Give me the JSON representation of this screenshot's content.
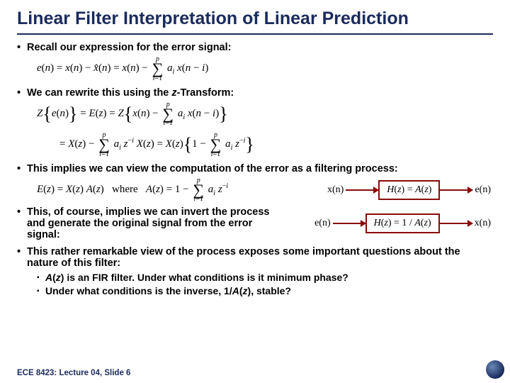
{
  "title": "Linear Filter Interpretation of Linear Prediction",
  "bullets": {
    "recall": "Recall our expression for the error signal:",
    "rewrite": "We can rewrite this using the z-Transform:",
    "implies_filter": "This implies we can view the computation of the error as a filtering process:",
    "invert": "This, of course, implies we can invert the process and generate the original signal from the error signal:",
    "questions": "This rather remarkable view of the process exposes some important questions about the nature of this filter:",
    "sub_a": "A(z) is an FIR filter. Under what conditions is it minimum phase?",
    "sub_b": "Under what conditions is the inverse, 1/A(z), stable?"
  },
  "equations": {
    "error": "e(n) = x(n) − x̂(n) = x(n) − Σ_{i=1}^{p} a_i x(n − i)",
    "ztrans_line1": "Z{ e(n) } = E(z) = Z{ x(n) − Σ_{i=1}^{p} a_i x(n − i) }",
    "ztrans_line2": "= X(z) − Σ_{i=1}^{p} a_i z^{−i} X(z) = X(z){ 1 − Σ_{i=1}^{p} a_i z^{−i} }",
    "ez_def": "E(z) = X(z) A(z)   where   A(z) = 1 − Σ_{i=1}^{p} a_i z^{−i}"
  },
  "diagram1": {
    "in": "x(n)",
    "box": "H(z) = A(z)",
    "out": "e(n)"
  },
  "diagram2": {
    "in": "e(n)",
    "box": "H(z) = 1 / A(z)",
    "out": "x(n)"
  },
  "footer": "ECE 8423: Lecture 04, Slide 6"
}
